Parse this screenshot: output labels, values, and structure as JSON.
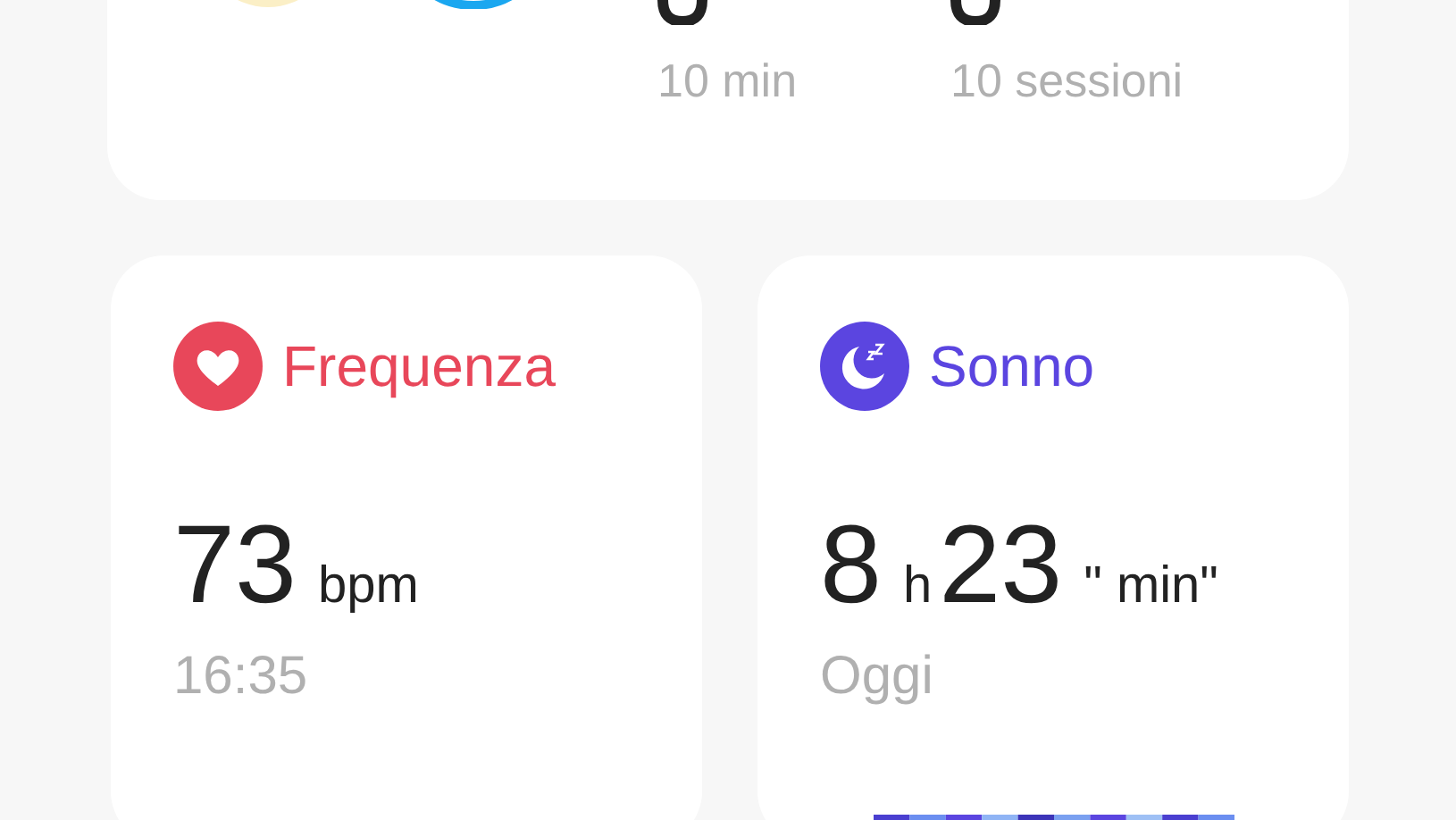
{
  "summary": {
    "stats": [
      {
        "label": "10 min"
      },
      {
        "label": "10 sessioni"
      }
    ]
  },
  "cards": [
    {
      "kind": "heart",
      "title": "Frequenza",
      "color": "#e8475a",
      "value_parts": [
        {
          "kind": "number",
          "text": "73"
        },
        {
          "kind": "unit",
          "text": "bpm"
        }
      ],
      "subtitle": "16:35"
    },
    {
      "kind": "sleep",
      "title": "Sonno",
      "color": "#5b45e0",
      "value_parts": [
        {
          "kind": "number",
          "text": "8"
        },
        {
          "kind": "unit",
          "text": "h"
        },
        {
          "kind": "number",
          "text": "23"
        },
        {
          "kind": "unit",
          "text": "\" min\""
        }
      ],
      "subtitle": "Oggi"
    }
  ]
}
